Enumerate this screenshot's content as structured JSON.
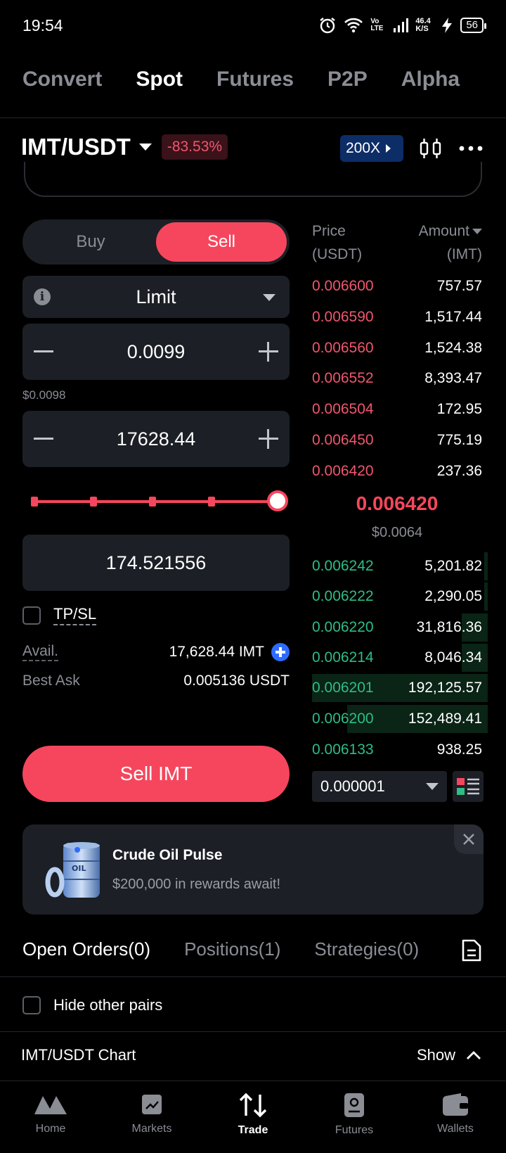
{
  "status_bar": {
    "time": "19:54",
    "network": "46.4 K/S",
    "battery": "56",
    "volte": "Vo LTE"
  },
  "top_tabs": [
    "Convert",
    "Spot",
    "Futures",
    "P2P",
    "Alpha"
  ],
  "header": {
    "pair": "IMT/USDT",
    "change": "-83.53%",
    "leverage": "200X"
  },
  "order_form": {
    "buy_label": "Buy",
    "sell_label": "Sell",
    "order_type": "Limit",
    "price": "0.0099",
    "price_usd": "$0.0098",
    "amount": "17628.44",
    "slider_percent": 100,
    "total": "174.521556",
    "tpsl_label": "TP/SL",
    "avail_label": "Avail.",
    "avail_value": "17,628.44 IMT",
    "best_ask_label": "Best Ask",
    "best_ask_value": "0.005136 USDT",
    "submit_label": "Sell IMT"
  },
  "order_book": {
    "price_header_1": "Price",
    "price_header_2": "(USDT)",
    "amount_header_1": "Amount",
    "amount_header_2": "(IMT)",
    "asks": [
      {
        "price": "0.006600",
        "amount": "757.57"
      },
      {
        "price": "0.006590",
        "amount": "1,517.44"
      },
      {
        "price": "0.006560",
        "amount": "1,524.38"
      },
      {
        "price": "0.006552",
        "amount": "8,393.47"
      },
      {
        "price": "0.006504",
        "amount": "172.95"
      },
      {
        "price": "0.006450",
        "amount": "775.19"
      },
      {
        "price": "0.006420",
        "amount": "237.36"
      }
    ],
    "last_price": "0.006420",
    "last_price_usd": "$0.0064",
    "bids": [
      {
        "price": "0.006242",
        "amount": "5,201.82",
        "depth": 0.02
      },
      {
        "price": "0.006222",
        "amount": "2,290.05",
        "depth": 0.02
      },
      {
        "price": "0.006220",
        "amount": "31,816.36",
        "depth": 0.15
      },
      {
        "price": "0.006214",
        "amount": "8,046.34",
        "depth": 0.15
      },
      {
        "price": "0.006201",
        "amount": "192,125.57",
        "depth": 1.0
      },
      {
        "price": "0.006200",
        "amount": "152,489.41",
        "depth": 0.8
      },
      {
        "price": "0.006133",
        "amount": "938.25",
        "depth": 0
      }
    ],
    "precision": "0.000001"
  },
  "banner": {
    "title": "Crude Oil Pulse",
    "subtitle": "$200,000 in rewards await!",
    "badge": "OIL"
  },
  "order_tabs": [
    "Open Orders(0)",
    "Positions(1)",
    "Strategies(0)"
  ],
  "hide_pairs_label": "Hide other pairs",
  "chart_row": {
    "label": "IMT/USDT Chart",
    "action": "Show"
  },
  "bottom_nav": [
    "Home",
    "Markets",
    "Trade",
    "Futures",
    "Wallets"
  ],
  "colors": {
    "sell": "#f6465d",
    "buy": "#2ebd85",
    "accent": "#2f6bff",
    "panel": "#1c1f26"
  }
}
